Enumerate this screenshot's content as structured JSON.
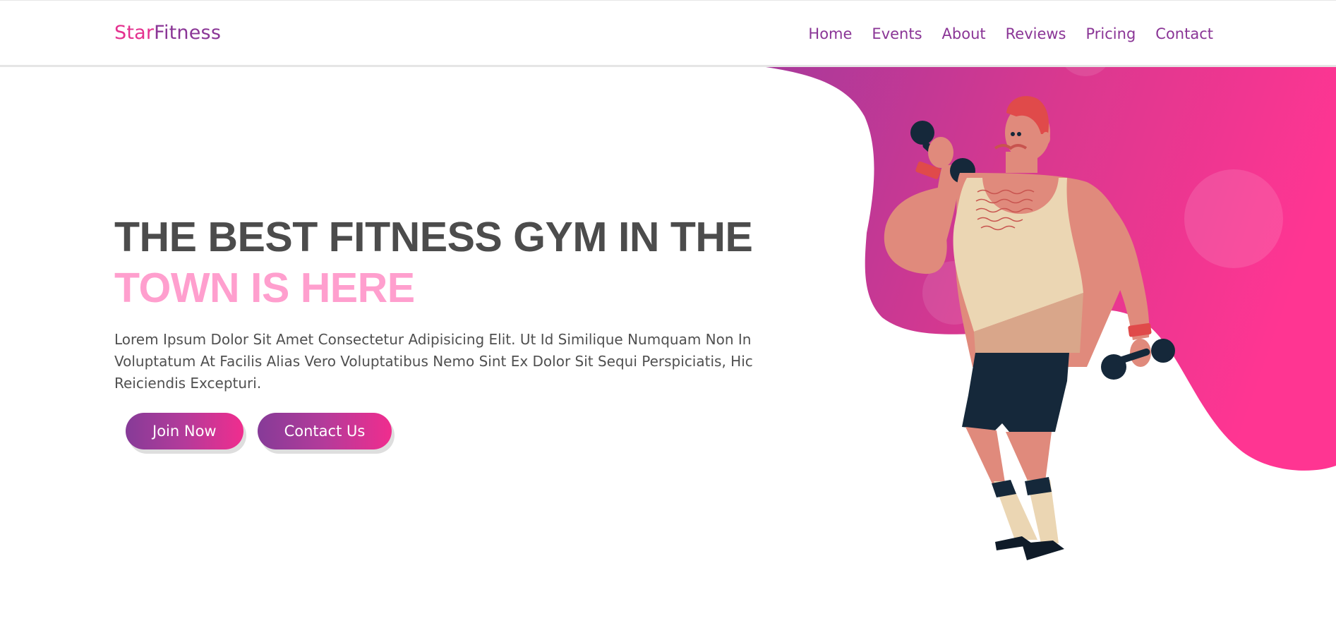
{
  "brand": {
    "part1": "Star",
    "part2": "Fitness"
  },
  "nav": {
    "items": [
      "Home",
      "Events",
      "About",
      "Reviews",
      "Pricing",
      "Contact"
    ]
  },
  "hero": {
    "headline_line1": "THE BEST FITNESS GYM IN THE",
    "headline_line2": "TOWN IS HERE",
    "description": "Lorem Ipsum Dolor Sit Amet Consectetur Adipisicing Elit. Ut Id Similique Numquam Non In Voluptatum At Facilis Alias Vero Voluptatibus Nemo Sint Ex Dolor Sit Sequi Perspiciatis, Hic Reiciendis Excepturi.",
    "join_label": "Join Now",
    "contact_label": "Contact Us"
  },
  "colors": {
    "brand_pink": "#e4318f",
    "brand_purple": "#8a3596",
    "headline_gray": "#4c4c4c",
    "headline_pink": "#ff9fce",
    "blob_start": "#a8399b",
    "blob_end": "#ff3592"
  },
  "icons": {
    "hero_illustration": "muscleman-dumbbells-illustration"
  }
}
